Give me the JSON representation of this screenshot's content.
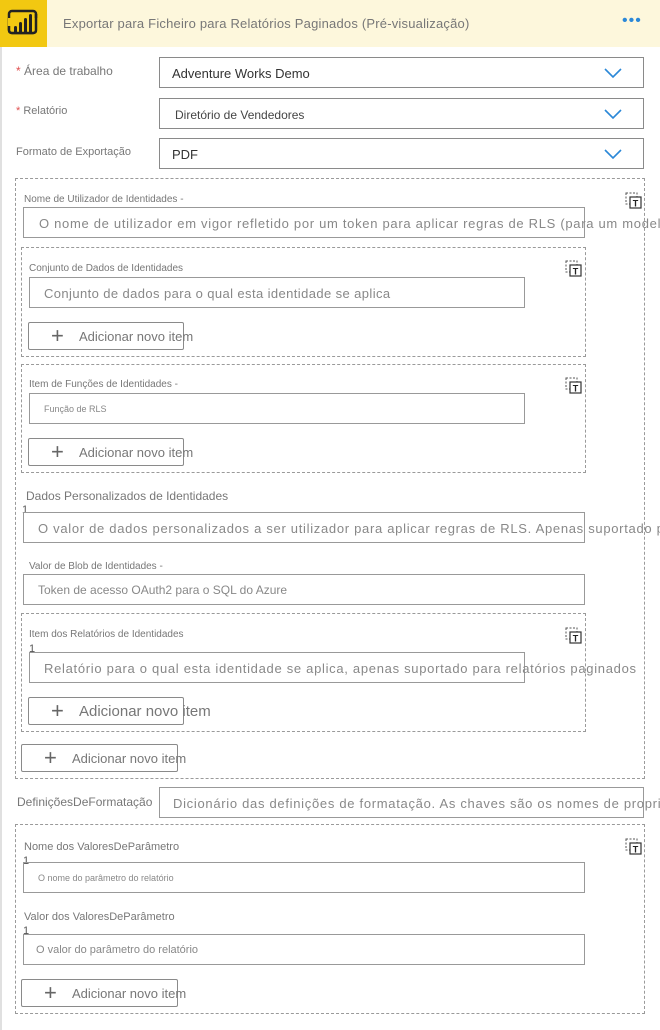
{
  "header": {
    "title": "Exportar para Ficheiro para Relatórios Paginados (Pré-visualização)",
    "logo_icon": "power-bi-logo",
    "more_icon": "ellipsis-icon",
    "more_label": "•••"
  },
  "fields": {
    "workspace": {
      "required_mark": "*",
      "label": "Área de trabalho",
      "value": "Adventure Works Demo"
    },
    "report": {
      "required_mark": "*",
      "label": "Relatório",
      "value": "Diretório de Vendedores"
    },
    "export_format": {
      "label": "Formato de Exportação",
      "value": "PDF"
    }
  },
  "identities": {
    "username": {
      "label": "Nome de Utilizador de Identidades -",
      "placeholder": "O nome de utilizador em vigor refletido por um token para aplicar regras de RLS (para um modelo no local"
    },
    "datasets": {
      "label": "Conjunto de Dados de Identidades",
      "placeholder": "Conjunto de dados para o qual esta identidade se aplica",
      "add_label": "Adicionar novo item"
    },
    "roles": {
      "label": "Item de Funções de Identidades -",
      "placeholder": "Função de RLS",
      "add_label": "Adicionar novo item"
    },
    "custom_data": {
      "label": "Dados Personalizados de Identidades",
      "index": "1",
      "placeholder": "O valor de dados personalizados a ser utilizador para aplicar regras de RLS. Apenas suportado para ligações"
    },
    "blob": {
      "label": "Valor de Blob de Identidades -",
      "placeholder": "Token de acesso OAuth2 para o SQL do Azure"
    },
    "reports": {
      "label": "Item dos Relatórios de Identidades",
      "index": "1",
      "placeholder": "Relatório para o qual esta identidade se aplica, apenas suportado para relatórios paginados",
      "add_label": "Adicionar novo item"
    },
    "add_label": "Adicionar novo item"
  },
  "format_settings": {
    "label": "DefiniçõesDeFormatação",
    "placeholder": "Dicionário das definições de formatação. As chaves são os nomes de propriedades"
  },
  "parameters": {
    "name": {
      "label": "Nome dos ValoresDeParâmetro",
      "index": "1",
      "placeholder": "O nome do parâmetro do relatório"
    },
    "value": {
      "label": "Valor dos ValoresDeParâmetro",
      "index": "1",
      "placeholder": "O valor do parâmetro do relatório"
    },
    "add_label": "Adicionar novo item"
  },
  "icons": {
    "switch_mode": "text-mode-toggle-icon",
    "dropdown": "chevron-down-icon",
    "add": "plus-icon"
  },
  "colors": {
    "brand_yellow": "#f2c811",
    "header_bg": "#fdf7dc",
    "accent_blue": "#2b88d8",
    "required_red": "#e05050"
  }
}
